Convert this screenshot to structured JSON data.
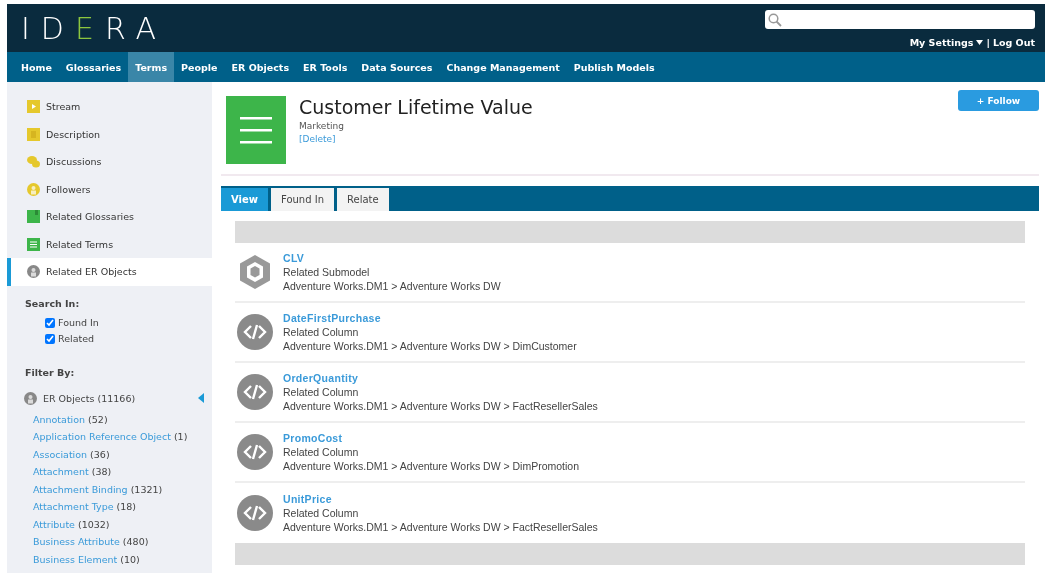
{
  "header": {
    "logo": "IDERA",
    "user_links": [
      {
        "label": "My Settings"
      },
      {
        "label": "Log Out"
      }
    ],
    "link_separator": "|"
  },
  "nav": [
    {
      "label": "Home",
      "selected": false
    },
    {
      "label": "Glossaries",
      "selected": false
    },
    {
      "label": "Terms",
      "selected": true
    },
    {
      "label": "People",
      "selected": false
    },
    {
      "label": "ER Objects",
      "selected": false
    },
    {
      "label": "ER Tools",
      "selected": false
    },
    {
      "label": "Data Sources",
      "selected": false
    },
    {
      "label": "Change Management",
      "selected": false
    },
    {
      "label": "Publish Models",
      "selected": false
    }
  ],
  "sidebar": {
    "items": [
      {
        "label": "Stream",
        "selected": false
      },
      {
        "label": "Description",
        "selected": false
      },
      {
        "label": "Discussions",
        "selected": false
      },
      {
        "label": "Followers",
        "selected": false
      },
      {
        "label": "Related Glossaries",
        "selected": false
      },
      {
        "label": "Related Terms",
        "selected": false
      },
      {
        "label": "Related ER Objects",
        "selected": true
      }
    ],
    "search_in": {
      "title": "Search In:",
      "options": [
        {
          "label": "Found In",
          "checked": true
        },
        {
          "label": "Related",
          "checked": true
        }
      ]
    },
    "filter_by": {
      "title": "Filter By:",
      "group": {
        "label": "ER Objects (11166)",
        "expanded": true
      },
      "items": [
        {
          "name": "Annotation",
          "count": "(52)"
        },
        {
          "name": "Application Reference Object",
          "count": "(1)"
        },
        {
          "name": "Association",
          "count": "(36)"
        },
        {
          "name": "Attachment",
          "count": "(38)"
        },
        {
          "name": "Attachment Binding",
          "count": "(1321)"
        },
        {
          "name": "Attachment Type",
          "count": "(18)"
        },
        {
          "name": "Attribute",
          "count": "(1032)"
        },
        {
          "name": "Business Attribute",
          "count": "(480)"
        },
        {
          "name": "Business Element",
          "count": "(10)"
        }
      ]
    }
  },
  "term": {
    "title": "Customer Lifetime Value",
    "category": "Marketing",
    "delete_link": "[Delete]",
    "follow_button": "+ Follow"
  },
  "tabs": [
    {
      "label": "View",
      "selected": true
    },
    {
      "label": "Found In",
      "selected": false
    },
    {
      "label": "Relate",
      "selected": false
    }
  ],
  "results": [
    {
      "kind": "submodel",
      "name": "CLV",
      "type": "Related Submodel",
      "path": "Adventure Works.DM1 > Adventure Works DW"
    },
    {
      "kind": "column",
      "name": "DateFirstPurchase",
      "type": "Related Column",
      "path": "Adventure Works.DM1 > Adventure Works DW > DimCustomer"
    },
    {
      "kind": "column",
      "name": "OrderQuantity",
      "type": "Related Column",
      "path": "Adventure Works.DM1 > Adventure Works DW > FactResellerSales"
    },
    {
      "kind": "column",
      "name": "PromoCost",
      "type": "Related Column",
      "path": "Adventure Works.DM1 > Adventure Works DW > DimPromotion"
    },
    {
      "kind": "column",
      "name": "UnitPrice",
      "type": "Related Column",
      "path": "Adventure Works.DM1 > Adventure Works DW > FactResellerSales"
    }
  ]
}
